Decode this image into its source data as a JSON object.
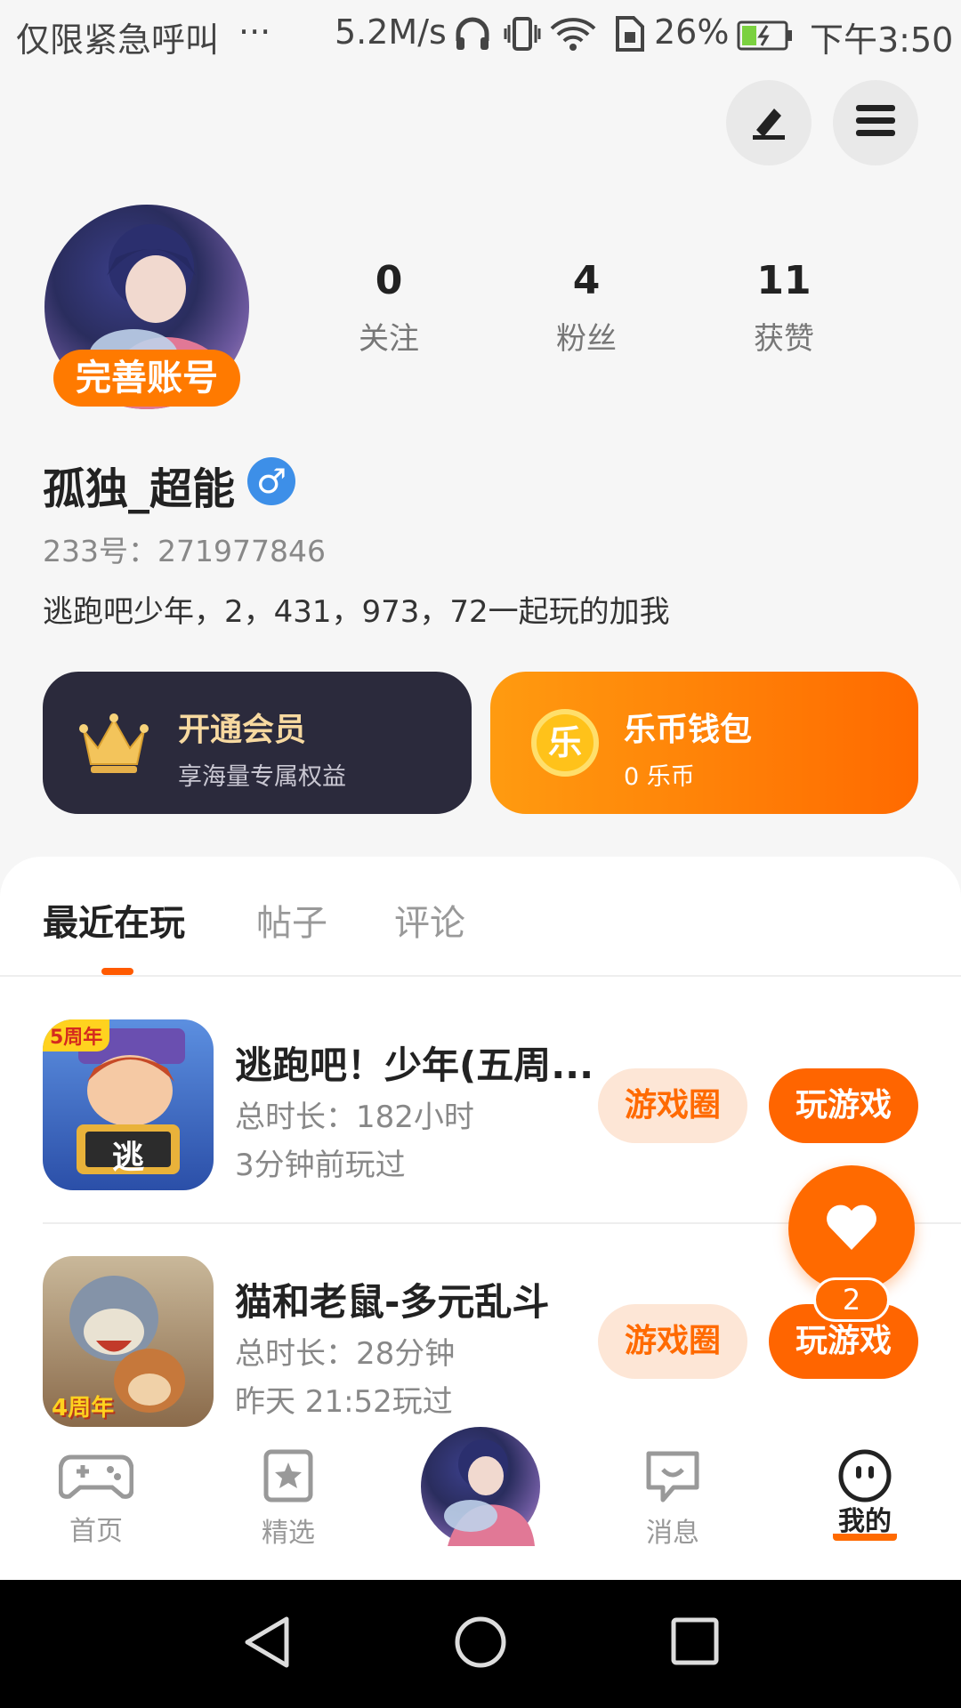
{
  "status_bar": {
    "carrier": "仅限紧急呼叫",
    "more": "···",
    "speed": "5.2M/s",
    "battery": "26%",
    "time": "下午3:50"
  },
  "profile": {
    "complete_badge": "完善账号",
    "stats": [
      {
        "value": "0",
        "label": "关注"
      },
      {
        "value": "4",
        "label": "粉丝"
      },
      {
        "value": "11",
        "label": "获赞"
      }
    ],
    "name": "孤独_超能",
    "gender_symbol": "♂",
    "uid": "233号：271977846",
    "bio": "逃跑吧少年，2，431，973，72一起玩的加我"
  },
  "cards": {
    "vip": {
      "title": "开通会员",
      "subtitle": "享海量专属权益"
    },
    "wallet": {
      "title": "乐币钱包",
      "subtitle": "0 乐币",
      "coin_glyph": "乐"
    }
  },
  "tabs": [
    {
      "label": "最近在玩",
      "active": true
    },
    {
      "label": "帖子",
      "active": false
    },
    {
      "label": "评论",
      "active": false
    }
  ],
  "games": [
    {
      "title": "逃跑吧！少年(五周...",
      "duration": "总时长：182小时",
      "last_played": "3分钟前玩过",
      "circle_label": "游戏圈",
      "play_label": "玩游戏",
      "icon_glyph": "逃",
      "icon_tag": "5周年"
    },
    {
      "title": "猫和老鼠-多元乱斗",
      "duration": "总时长：28分钟",
      "last_played": "昨天 21:52玩过",
      "circle_label": "游戏圈",
      "play_label": "玩游戏",
      "icon_tag": "4周年"
    }
  ],
  "fab": {
    "count": "2"
  },
  "bottom_nav": [
    {
      "label": "首页",
      "icon": "gamepad-icon"
    },
    {
      "label": "精选",
      "icon": "star-bookmark-icon"
    },
    {
      "label": "消息",
      "icon": "chat-bubble-icon"
    },
    {
      "label": "我的",
      "icon": "smiley-face-icon",
      "active": true
    }
  ],
  "colors": {
    "accent": "#ff6a00",
    "vip_card": "#2b2a3c",
    "vip_text": "#f7d9a0",
    "gender_badge": "#3d8fe8"
  }
}
